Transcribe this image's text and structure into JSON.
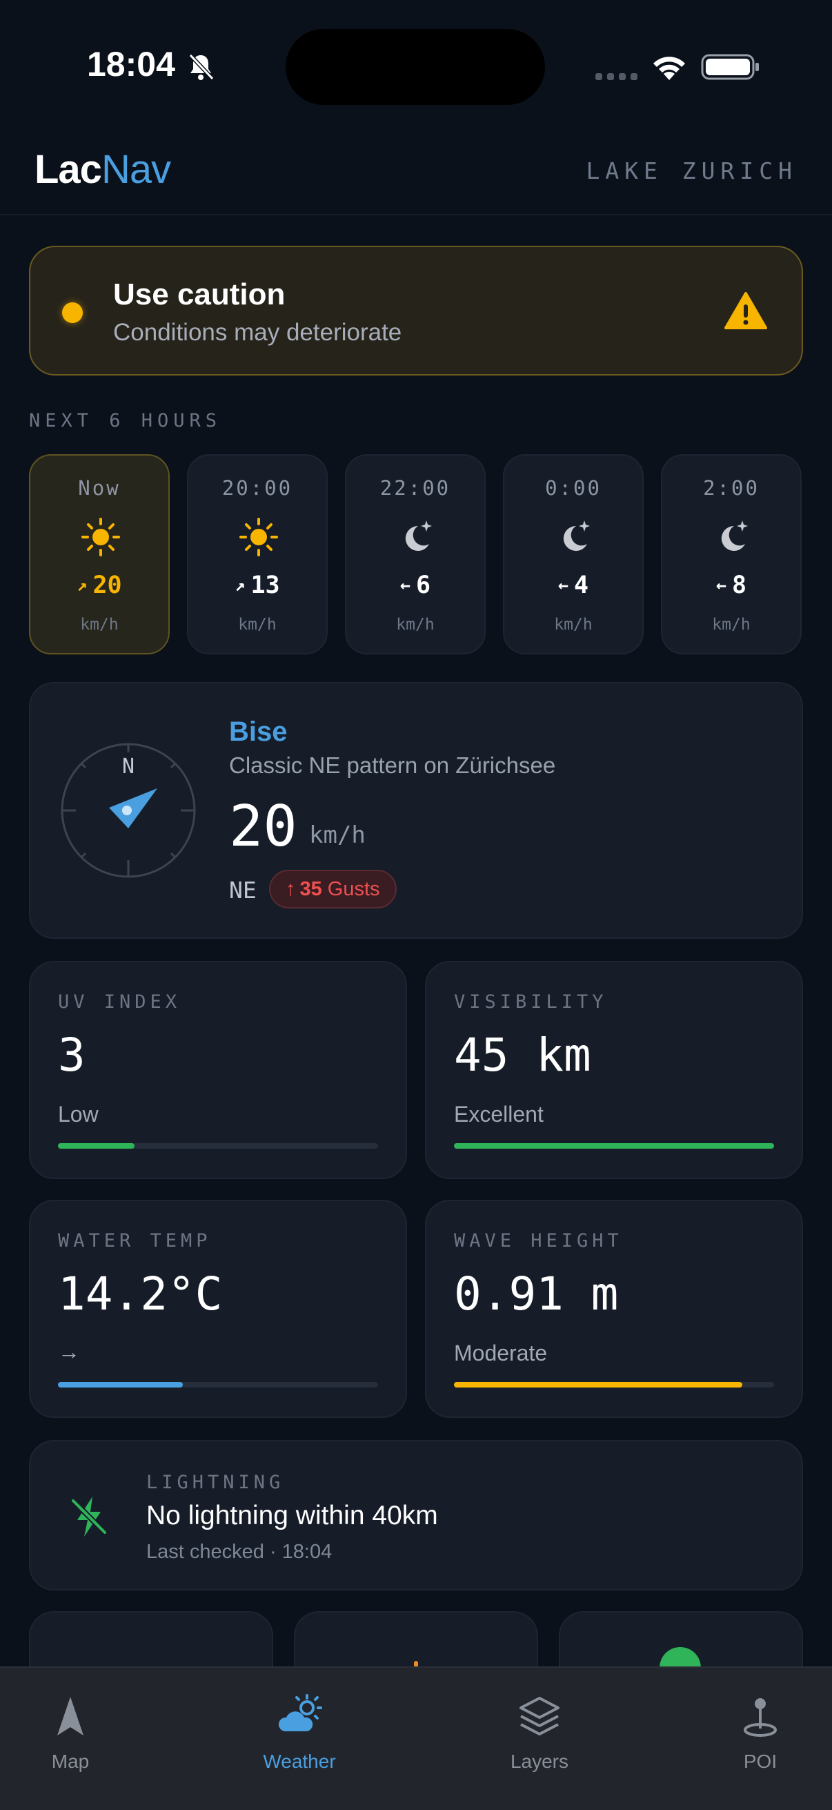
{
  "status_bar": {
    "time": "18:04"
  },
  "header": {
    "logo_part1": "Lac",
    "logo_part2": "Nav",
    "location": "LAKE ZURICH"
  },
  "caution": {
    "title": "Use caution",
    "subtitle": "Conditions may deteriorate"
  },
  "forecast": {
    "label": "NEXT 6 HOURS",
    "hours": [
      {
        "time": "Now",
        "icon": "sun-icon",
        "arrow": "↗",
        "wind": "20",
        "unit": "km/h"
      },
      {
        "time": "20:00",
        "icon": "sun-icon",
        "arrow": "↗",
        "wind": "13",
        "unit": "km/h"
      },
      {
        "time": "22:00",
        "icon": "moon-stars-icon",
        "arrow": "←",
        "wind": "6",
        "unit": "km/h"
      },
      {
        "time": "0:00",
        "icon": "moon-stars-icon",
        "arrow": "←",
        "wind": "4",
        "unit": "km/h"
      },
      {
        "time": "2:00",
        "icon": "moon-stars-icon",
        "arrow": "←",
        "wind": "8",
        "unit": "km/h"
      }
    ]
  },
  "wind": {
    "compass_n": "N",
    "name": "Bise",
    "description": "Classic NE pattern on Zürichsee",
    "speed": "20",
    "unit": "km/h",
    "direction": "NE",
    "gust_arrow": "↑",
    "gust_value": "35",
    "gust_label": "Gusts"
  },
  "metrics": {
    "uv": {
      "label": "UV INDEX",
      "value": "3",
      "sub": "Low",
      "level": 0.24,
      "color": "#2fb45a"
    },
    "visibility": {
      "label": "VISIBILITY",
      "value": "45 km",
      "sub": "Excellent",
      "level": 1.0,
      "color": "#2fb45a"
    },
    "water": {
      "label": "WATER TEMP",
      "value": "14.2°C",
      "sub": "→",
      "level": 0.39,
      "color": "#4a9fe0"
    },
    "wave": {
      "label": "WAVE HEIGHT",
      "value": "0.91 m",
      "sub": "Moderate",
      "level": 0.9,
      "color": "#f7b500"
    }
  },
  "lightning": {
    "label": "LIGHTNING",
    "title": "No lightning within 40km",
    "sub": "Last checked · 18:04"
  },
  "tabs": [
    {
      "label": "Map",
      "icon": "navigation-arrow-icon",
      "active": false
    },
    {
      "label": "Weather",
      "icon": "partly-cloudy-icon",
      "active": true
    },
    {
      "label": "Layers",
      "icon": "layers-icon",
      "active": false
    },
    {
      "label": "POI",
      "icon": "map-pin-icon",
      "active": false
    }
  ],
  "colors": {
    "accent": "#4a9fe0",
    "warning": "#f7b500",
    "danger": "#ef5050",
    "good": "#2fb45a",
    "background": "#0b111b"
  }
}
